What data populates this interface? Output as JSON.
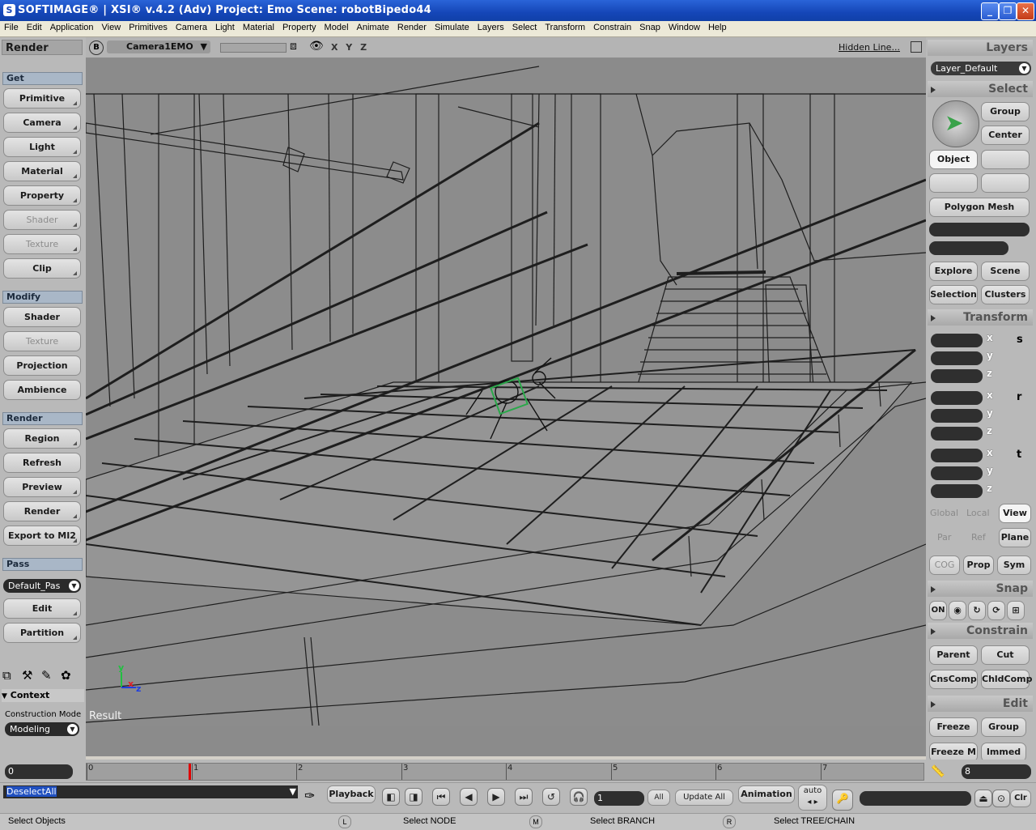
{
  "window": {
    "title": "SOFTIMAGE® | XSI® v.4.2 (Adv) Project: Emo     Scene: robotBipedo44",
    "app_icon": "S"
  },
  "menu": [
    "File",
    "Edit",
    "Application",
    "View",
    "Primitives",
    "Camera",
    "Light",
    "Material",
    "Property",
    "Model",
    "Animate",
    "Render",
    "Simulate",
    "Layers",
    "Select",
    "Transform",
    "Constrain",
    "Snap",
    "Window",
    "Help"
  ],
  "left": {
    "title": "Render",
    "sections": {
      "get": {
        "label": "Get",
        "buttons": [
          {
            "label": "Primitive",
            "enabled": true
          },
          {
            "label": "Camera",
            "enabled": true
          },
          {
            "label": "Light",
            "enabled": true
          },
          {
            "label": "Material",
            "enabled": true
          },
          {
            "label": "Property",
            "enabled": true
          },
          {
            "label": "Shader",
            "enabled": false
          },
          {
            "label": "Texture",
            "enabled": false
          },
          {
            "label": "Clip",
            "enabled": true
          }
        ]
      },
      "modify": {
        "label": "Modify",
        "buttons": [
          {
            "label": "Shader",
            "enabled": true
          },
          {
            "label": "Texture",
            "enabled": false
          },
          {
            "label": "Projection",
            "enabled": true
          },
          {
            "label": "Ambience",
            "enabled": true
          }
        ]
      },
      "render": {
        "label": "Render",
        "buttons": [
          {
            "label": "Region",
            "enabled": true
          },
          {
            "label": "Refresh",
            "enabled": true
          },
          {
            "label": "Preview",
            "enabled": true
          },
          {
            "label": "Render",
            "enabled": true
          },
          {
            "label": "Export to MI2",
            "enabled": true
          }
        ]
      },
      "pass": {
        "label": "Pass",
        "selected": "Default_Pas",
        "buttons": [
          {
            "label": "Edit"
          },
          {
            "label": "Partition"
          }
        ]
      }
    },
    "context": {
      "label": "Context",
      "mode_label": "Construction Mode",
      "mode_value": "Modeling"
    }
  },
  "viewport": {
    "view_letter": "B",
    "camera": "Camera1EMO",
    "axes": "X Y Z",
    "display_mode": "Hidden Line...",
    "result_label": "Result",
    "gizmo": {
      "y": "y",
      "x": "x",
      "z": "z"
    }
  },
  "right": {
    "layers": {
      "title": "Layers",
      "current": "Layer_Default"
    },
    "select": {
      "title": "Select",
      "group": "Group",
      "center": "Center",
      "object": "Object",
      "filter": "Polygon Mesh",
      "explore": "Explore",
      "scene": "Scene",
      "selection": "Selection",
      "clusters": "Clusters"
    },
    "transform": {
      "title": "Transform",
      "axes": [
        "x",
        "y",
        "z"
      ],
      "scale": "s",
      "rotate": "r",
      "translate": "t",
      "global": "Global",
      "local": "Local",
      "view": "View",
      "par": "Par",
      "ref": "Ref",
      "plane": "Plane",
      "cog": "COG",
      "prop": "Prop",
      "sym": "Sym"
    },
    "snap": {
      "title": "Snap",
      "on": "ON"
    },
    "constrain": {
      "title": "Constrain",
      "parent": "Parent",
      "cut": "Cut",
      "cnscomp": "CnsComp",
      "chldcomp": "ChldComp"
    },
    "edit": {
      "title": "Edit",
      "freeze": "Freeze",
      "group": "Group",
      "freezem": "Freeze M",
      "immed": "Immed"
    }
  },
  "timeline": {
    "start": "0",
    "end": "8",
    "ticks": [
      "0",
      "1",
      "2",
      "3",
      "4",
      "5",
      "6",
      "7"
    ],
    "current_frame": 1
  },
  "controls": {
    "command": "DeselectAll",
    "playback": "Playback",
    "frame": "1",
    "all": "All",
    "update_all": "Update All",
    "animation": "Animation",
    "auto": "auto",
    "clr": "Clr"
  },
  "status": {
    "left": "Select Objects",
    "l_key": "L",
    "l_text": "Select NODE",
    "m_key": "M",
    "m_text": "Select BRANCH",
    "r_key": "R",
    "r_text": "Select TREE/CHAIN"
  },
  "colors": {
    "title_bar": "#1546b8",
    "viewport_bg": "#8b8b8b",
    "wire": "#1e1e1e",
    "gizmo_x": "#e0202a",
    "gizmo_y": "#20c040",
    "gizmo_z": "#2040e0",
    "selected": "#2aa84a"
  }
}
